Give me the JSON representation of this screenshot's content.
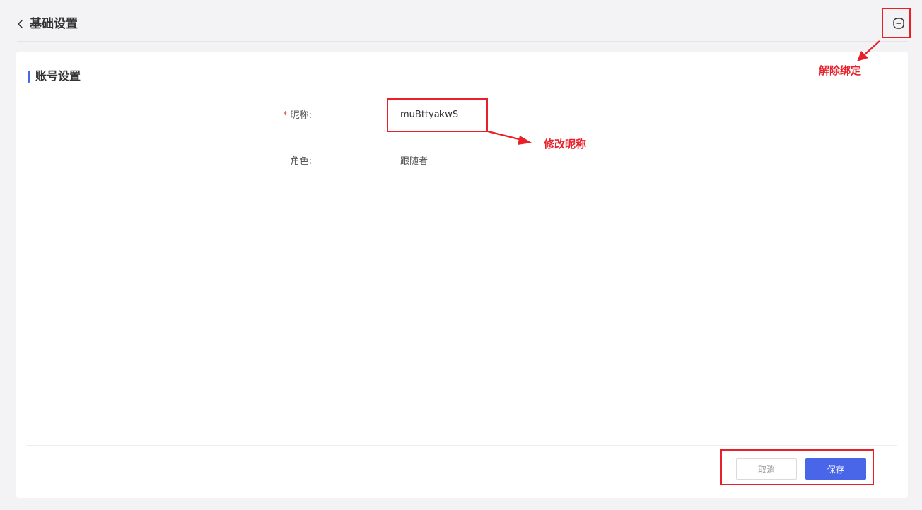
{
  "header": {
    "title": "基础设置",
    "back_icon": "chevron-left-icon",
    "unbind_icon": "minus-circle-icon"
  },
  "section": {
    "title": "账号设置",
    "accent_color": "#4966e8"
  },
  "form": {
    "nickname": {
      "required_mark": "*",
      "label": "昵称:",
      "value": "muBttyakwS"
    },
    "role": {
      "label": "角色:",
      "value": "跟随者"
    }
  },
  "footer": {
    "cancel_label": "取消",
    "save_label": "保存"
  },
  "annotations": {
    "color": "#e8202a",
    "unbind_note": "解除绑定",
    "nickname_note": "修改昵称"
  }
}
